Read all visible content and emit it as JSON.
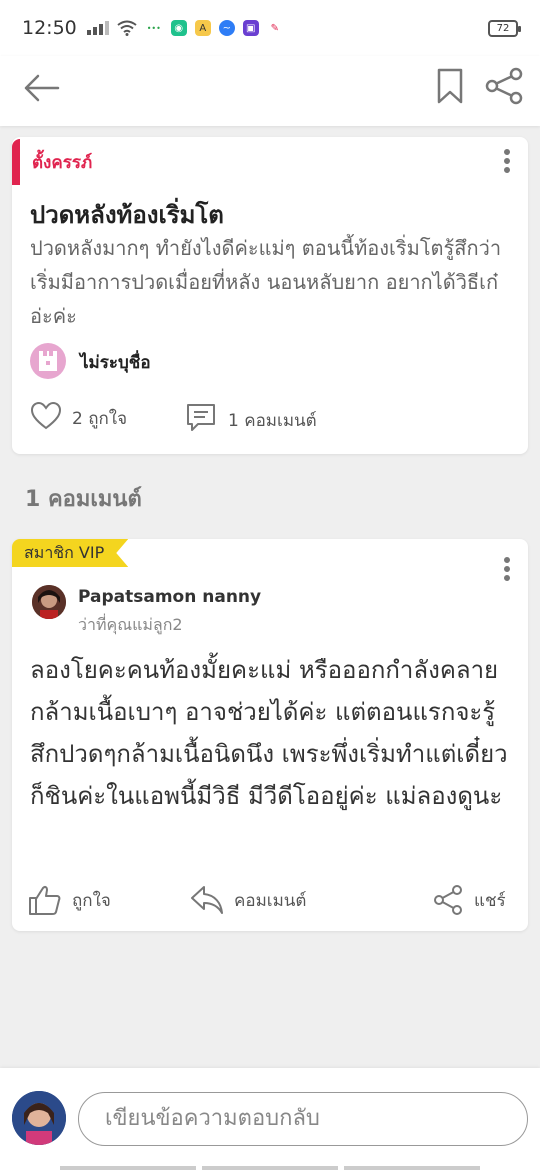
{
  "status_bar": {
    "time": "12:50",
    "battery": "72"
  },
  "post": {
    "tag": "ตั้งครรภ์",
    "title": "ปวดหลังท้องเริ่มโต",
    "body": "ปวดหลังมากๆ ทำยังไงดีค่ะแม่ๆ ตอนนี้ท้องเริ่มโตรู้สึกว่าเริ่มมีอาการปวดเมื่อยที่หลัง นอนหลับยาก อยากได้วิธีเก๋อ่ะค่ะ",
    "author": "ไม่ระบุชื่อ",
    "likes": "2 ถูกใจ",
    "comments": "1 คอมเมนต์"
  },
  "comments_heading": "1 คอมเมนต์",
  "comment": {
    "badge": "สมาชิก VIP",
    "name": "Papatsamon nanny",
    "subtitle": "ว่าที่คุณแม่ลูก2",
    "body": "ลองโยคะคนท้องมั้ยคะแม่ หรือออกกำลังคลายกล้ามเนื้อเบาๆ อาจช่วยได้ค่ะ แต่ตอนแรกจะรู้สึกปวดๆกล้ามเนื้อนิดนึง เพระพึ่งเริ่มทำแต่เดี๋ยวก็ชินค่ะในแอพนี้มีวิธี มีวีดีโออยู่ค่ะ แม่ลองดูนะ",
    "like_label": "ถูกใจ",
    "comment_label": "คอมเมนต์",
    "share_label": "แชร์"
  },
  "reply": {
    "placeholder": "เขียนข้อความตอบกลับ"
  },
  "colors": {
    "accent_red": "#e0244f",
    "vip_yellow": "#f4d51f"
  }
}
